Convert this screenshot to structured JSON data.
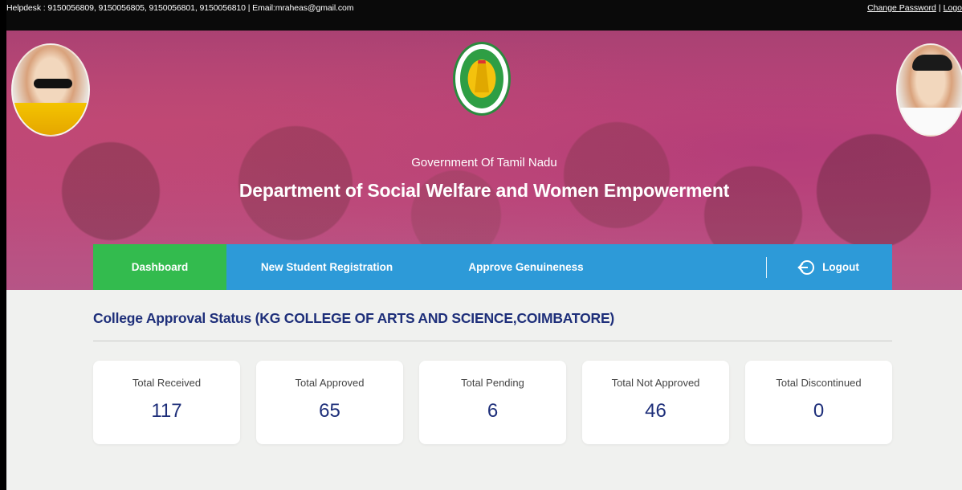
{
  "topbar": {
    "helpdesk": "Helpdesk : 9150056809, 9150056805, 9150056801, 9150056810 | Email:mraheas@gmail.com",
    "change_password": "Change Password",
    "separator": "|",
    "logout_link": "Logo"
  },
  "header": {
    "government": "Government Of Tamil Nadu",
    "department": "Department of Social Welfare and Women Empowerment"
  },
  "nav": {
    "items": [
      {
        "label": "Dashboard",
        "active": true
      },
      {
        "label": "New Student Registration"
      },
      {
        "label": "Approve Genuineness"
      },
      {
        "label": "Logout",
        "icon": "logout-icon"
      }
    ]
  },
  "main": {
    "title": "College Approval Status (KG COLLEGE OF ARTS AND SCIENCE,COIMBATORE)",
    "cards": [
      {
        "label": "Total Received",
        "value": "117"
      },
      {
        "label": "Total Approved",
        "value": "65"
      },
      {
        "label": "Total Pending",
        "value": "6"
      },
      {
        "label": "Total Not Approved",
        "value": "46"
      },
      {
        "label": "Total Discontinued",
        "value": "0"
      }
    ]
  },
  "colors": {
    "nav_bg": "#2d9ad8",
    "nav_active": "#33bb4e",
    "heading": "#1e2f7a",
    "banner": "#bf4a7c"
  }
}
